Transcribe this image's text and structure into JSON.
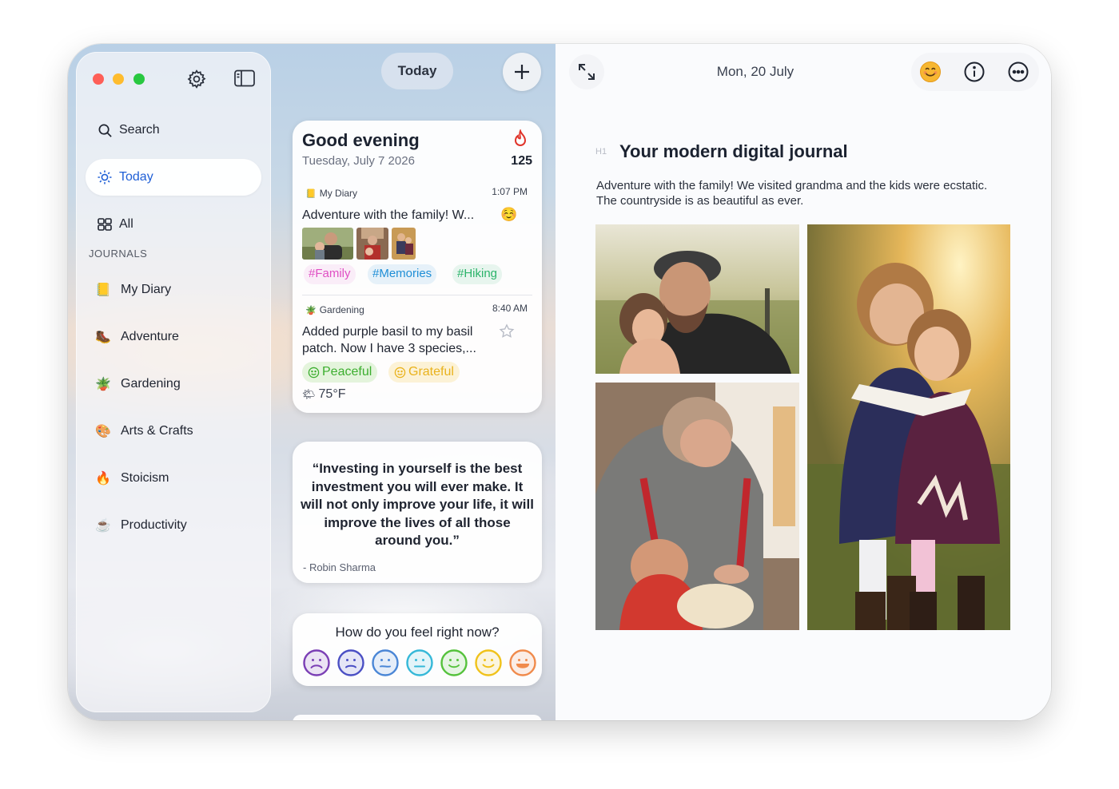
{
  "sidebar": {
    "search_label": "Search",
    "today_label": "Today",
    "all_label": "All",
    "journals_heading": "JOURNALS",
    "journals": [
      {
        "emoji": "📒",
        "label": "My Diary"
      },
      {
        "emoji": "🥾",
        "label": "Adventure"
      },
      {
        "emoji": "🪴",
        "label": "Gardening"
      },
      {
        "emoji": "🎨",
        "label": "Arts & Crafts"
      },
      {
        "emoji": "🔥",
        "label": "Stoicism"
      },
      {
        "emoji": "☕",
        "label": "Productivity"
      }
    ]
  },
  "middle": {
    "today_button": "Today",
    "greeting_card": {
      "greeting": "Good evening",
      "date": "Tuesday, July 7 2026",
      "streak": "125",
      "entries": [
        {
          "journal_emoji": "📒",
          "journal": "My Diary",
          "time": "1:07 PM",
          "title": "Adventure with the family! W...",
          "mood_emoji": "☺️",
          "tags": [
            "#Family",
            "#Memories",
            "#Hiking"
          ]
        },
        {
          "journal_emoji": "🪴",
          "journal": "Gardening",
          "time": "8:40 AM",
          "title_line1": "Added purple basil to my basil",
          "title_line2": "patch. Now I have 3 species,...",
          "moods": [
            "Peaceful",
            "Grateful"
          ],
          "weather_emoji": "🌤",
          "weather": "75°F"
        }
      ]
    },
    "quote": {
      "text": "“Investing in yourself is the best investment you will ever make. It will not only improve your life, it will improve the lives of all those around you.”",
      "author": "- Robin Sharma"
    },
    "feeling": {
      "prompt": "How do you feel right now?",
      "face_colors": [
        "#7b3fb5",
        "#4a4fc4",
        "#4a86d6",
        "#35b8d8",
        "#55c23c",
        "#f0c21a",
        "#f08a4b"
      ]
    }
  },
  "editor": {
    "date": "Mon, 20 July",
    "heading_marker": "H1",
    "title": "Your modern digital journal",
    "body": "Adventure with the family! We visited grandma and the kids were ecstatic. The countryside is as beautiful as ever."
  },
  "colors": {
    "accent": "#1f5fd6",
    "tag_family": "#e04fc4",
    "tag_memories": "#1f8ed6",
    "tag_hiking": "#2bb36a",
    "peaceful": "#3cae2f",
    "grateful": "#e9b21c"
  }
}
